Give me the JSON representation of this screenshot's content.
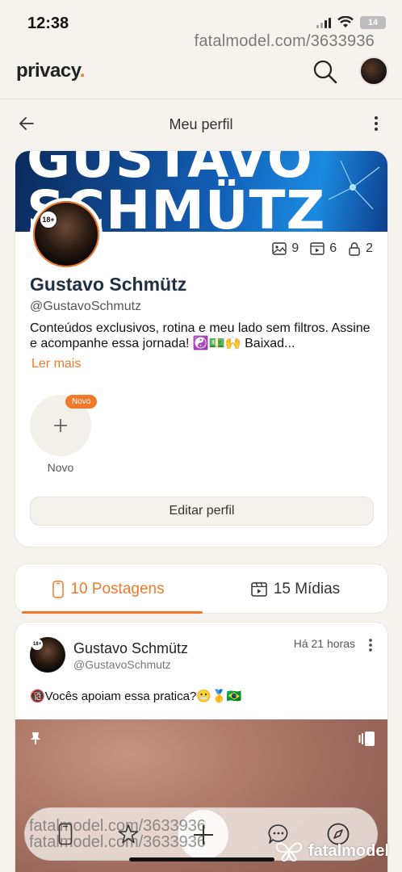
{
  "status_bar": {
    "time": "12:38",
    "battery": "14"
  },
  "watermark": "fatalmodel.com/3633936",
  "app": {
    "logo": "privacy",
    "logo_dot": "."
  },
  "subnav": {
    "title": "Meu perfil"
  },
  "profile": {
    "banner_text": "GUSTAVO\nSCHMÜTZ",
    "age_badge": "18+",
    "stats": {
      "images": "9",
      "videos": "6",
      "locked": "2"
    },
    "display_name": "Gustavo Schmütz",
    "handle": "@GustavoSchmutz",
    "bio": "Conteúdos exclusivos, rotina e meu lado sem filtros. Assine e acompanhe essa jornada! ☯️💵🙌 Baixad...",
    "read_more": "Ler mais",
    "new_story_badge": "Novo",
    "new_story_label": "Novo",
    "edit_button": "Editar perfil"
  },
  "tabs": {
    "posts": "10 Postagens",
    "media": "15 Mídias"
  },
  "post": {
    "name": "Gustavo Schmütz",
    "handle": "@GustavoSchmutz",
    "time": "Há 21 horas",
    "text": "🔞Vocês apoiam essa pratica?😬🥇🇧🇷",
    "age_badge": "18+"
  },
  "footer_logo": "fatalmodel",
  "colors": {
    "accent": "#f07a2a",
    "background": "#f6f3ee",
    "title": "#1f2f45"
  }
}
